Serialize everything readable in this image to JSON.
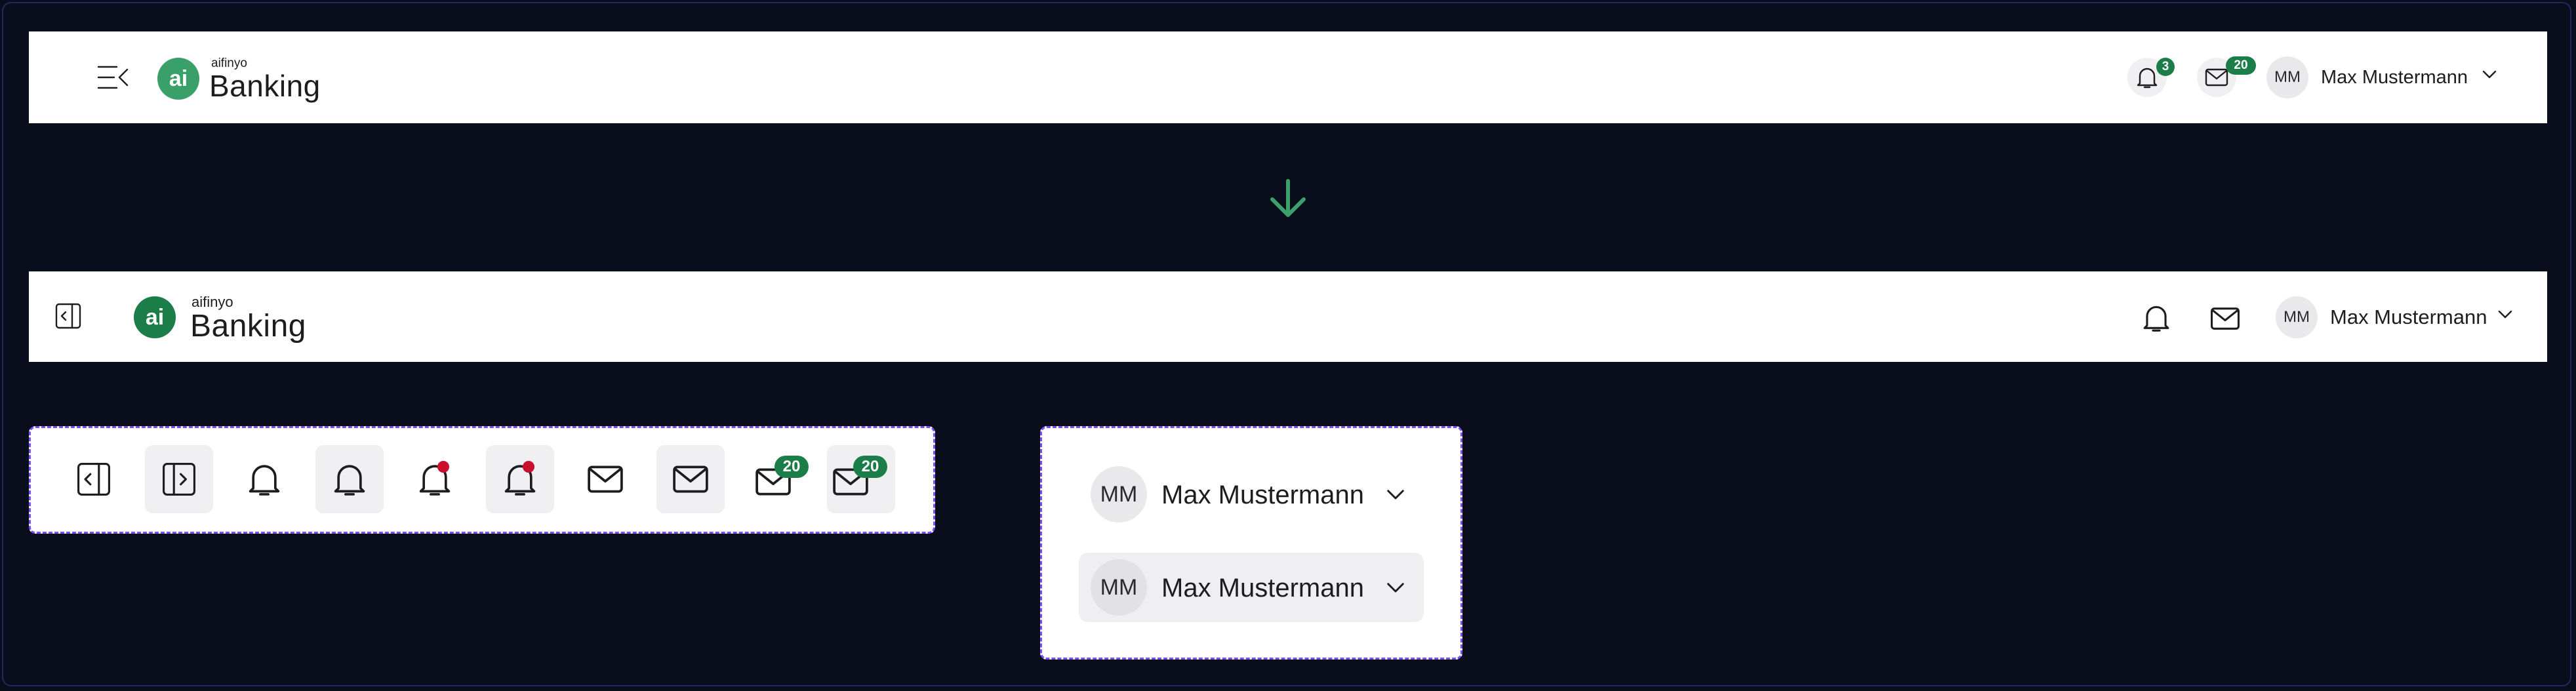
{
  "colors": {
    "background": "#0a0d1c",
    "brand_green_old": "#3aa06a",
    "brand_green": "#1b7d48",
    "badge_green": "#1b7d48",
    "notification_red": "#c8102e",
    "panel_border": "#7c4dff"
  },
  "old_header": {
    "menu_icon": "menu-collapse-icon",
    "brand": {
      "small": "aifinyo",
      "big": "Banking",
      "logo_glyph": "ai"
    },
    "notifications_badge": "3",
    "messages_badge": "20",
    "user": {
      "initials": "MM",
      "name": "Max Mustermann"
    }
  },
  "arrow_icon": "arrow-down-icon",
  "new_header": {
    "sidebar_toggle_icon": "sidebar-toggle-icon",
    "brand": {
      "small": "aifinyo",
      "big": "Banking",
      "logo_glyph": "ai"
    },
    "user": {
      "initials": "MM",
      "name": "Max Mustermann"
    }
  },
  "icon_states": {
    "message_badge": "20"
  },
  "user_states": [
    {
      "initials": "MM",
      "name": "Max Mustermann",
      "state": "default"
    },
    {
      "initials": "MM",
      "name": "Max Mustermann",
      "state": "hover"
    }
  ]
}
